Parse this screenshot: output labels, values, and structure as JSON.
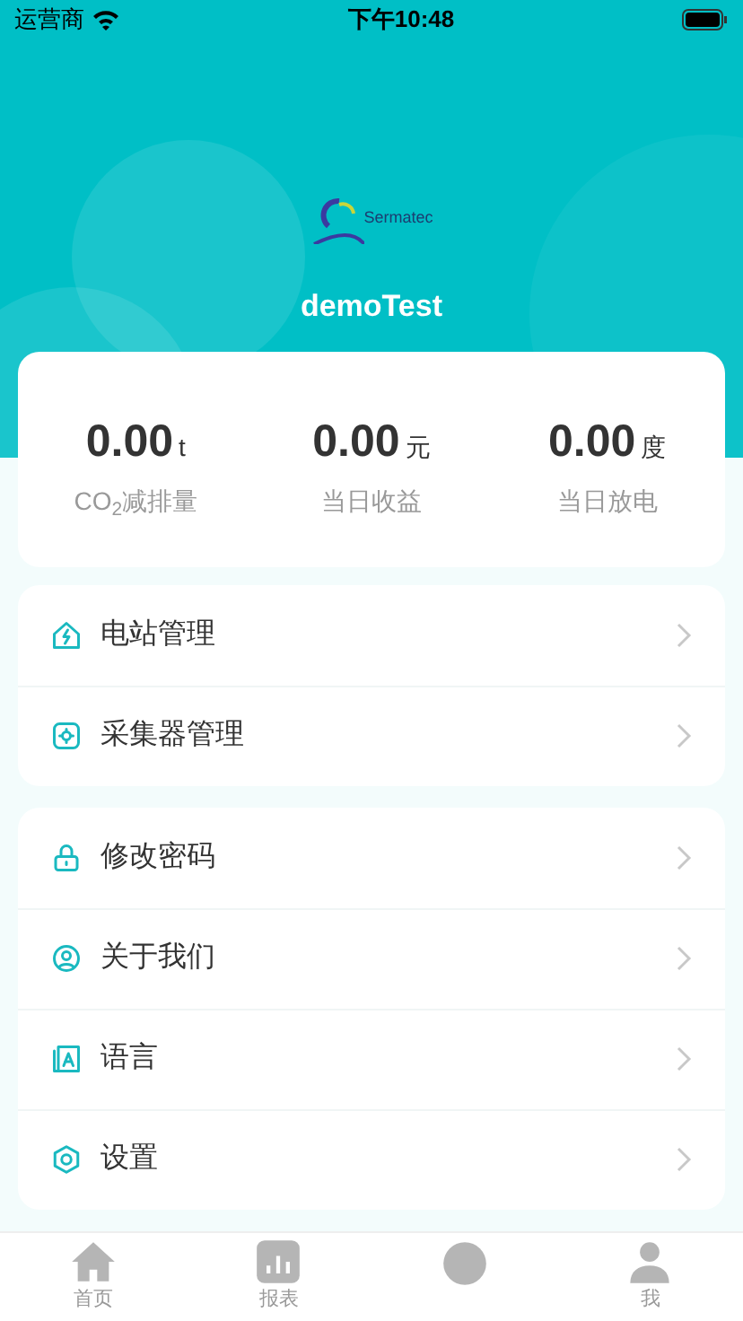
{
  "status_bar": {
    "carrier": "运营商",
    "time": "下午10:48"
  },
  "header": {
    "logo_text": "Sermatec",
    "username": "demoTest"
  },
  "stats": [
    {
      "value": "0.00",
      "unit": "t",
      "label": "CO$_{2}$减排量"
    },
    {
      "value": "0.00",
      "unit": "元",
      "label": "当日收益"
    },
    {
      "value": "0.00",
      "unit": "度",
      "label": "当日放电"
    }
  ],
  "menu_groups": [
    [
      {
        "kind": "station",
        "label": "电站管理"
      },
      {
        "kind": "collector",
        "label": "采集器管理"
      }
    ],
    [
      {
        "kind": "lock",
        "label": "修改密码"
      },
      {
        "kind": "about",
        "label": "关于我们"
      },
      {
        "kind": "language",
        "label": "语言"
      },
      {
        "kind": "settings",
        "label": "设置"
      }
    ]
  ],
  "tab_bar": [
    {
      "kind": "home",
      "label": "首页"
    },
    {
      "kind": "report",
      "label": "报表"
    },
    {
      "kind": "control"
    },
    {
      "kind": "me",
      "label": "我"
    }
  ]
}
